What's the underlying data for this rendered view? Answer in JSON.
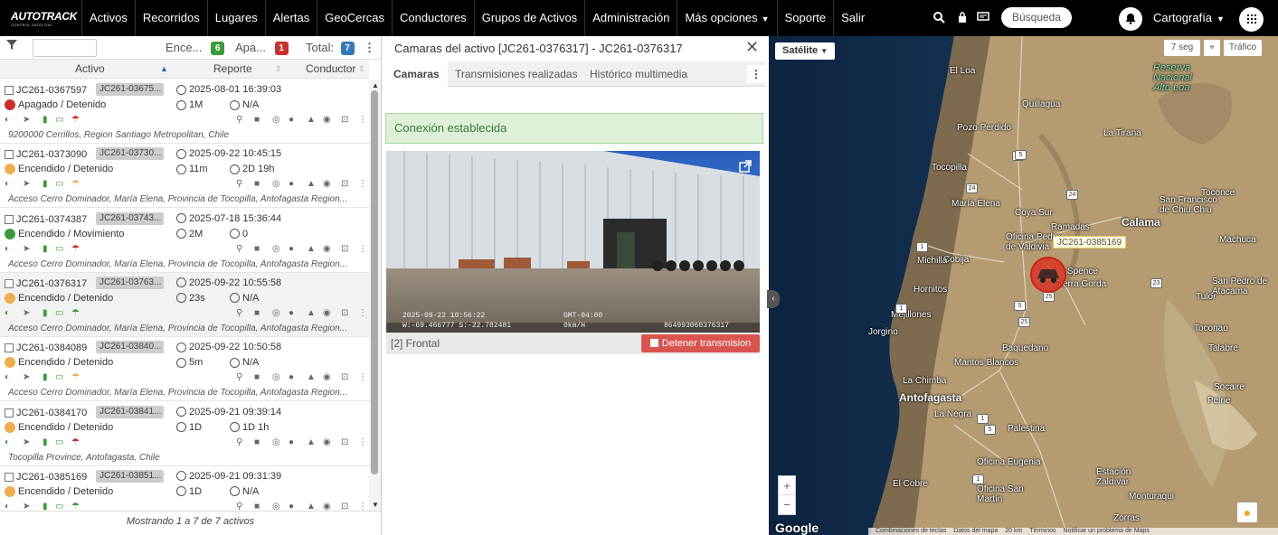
{
  "header": {
    "logo_text": "AUTOTRACK",
    "logo_sub": "CONTROL SATELITAL",
    "nav": [
      "Activos",
      "Recorridos",
      "Lugares",
      "Alertas",
      "GeoCercas",
      "Conductores",
      "Grupos de Activos",
      "Administración",
      "Más opciones",
      "Soporte",
      "Salir"
    ],
    "search_label": "Búsqueda",
    "map_layer_label": "Cartografía"
  },
  "asset_list": {
    "counts": {
      "on_label": "Ence...",
      "on_count": "6",
      "off_label": "Apa...",
      "off_count": "1",
      "total_label": "Total:",
      "total_count": "7"
    },
    "columns": {
      "asset": "Activo",
      "report": "Reporte",
      "driver": "Conductor"
    },
    "rows": [
      {
        "id": "JC261-0367597",
        "chip": "JC261-03675...",
        "report": "2025-08-01 16:39:03",
        "status": "Apagado / Detenido",
        "status_color": "#c9302c",
        "m1": "1M",
        "m2": "N/A",
        "address": "9200000 Cerrillos, Region Santiago Metropolitan, Chile",
        "selected": false
      },
      {
        "id": "JC261-0373090",
        "chip": "JC261-03730...",
        "report": "2025-09-22 10:45:15",
        "status": "Encendido / Detenido",
        "status_color": "#f0ad4e",
        "m1": "11m",
        "m2": "2D 19h",
        "address": "Acceso Cerro Dominador, María Elena, Provincia de Tocopilla, Antofagasta Region...",
        "selected": false
      },
      {
        "id": "JC261-0374387",
        "chip": "JC261-03743...",
        "report": "2025-07-18 15:36:44",
        "status": "Encendido / Movimiento",
        "status_color": "#3c9a3c",
        "m1": "2M",
        "m2": "0",
        "address": "Acceso Cerro Dominador, María Elena, Provincia de Tocopilla, Antofagasta Region...",
        "selected": false
      },
      {
        "id": "JC261-0376317",
        "chip": "JC261-03763...",
        "report": "2025-09-22 10:55:58",
        "status": "Encendido / Detenido",
        "status_color": "#f0ad4e",
        "m1": "23s",
        "m2": "N/A",
        "address": "Acceso Cerro Dominador, María Elena, Provincia de Tocopilla, Antofagasta Region...",
        "selected": true
      },
      {
        "id": "JC261-0384089",
        "chip": "JC261-03840...",
        "report": "2025-09-22 10:50:58",
        "status": "Encendido / Detenido",
        "status_color": "#f0ad4e",
        "m1": "5m",
        "m2": "N/A",
        "address": "Acceso Cerro Dominador, María Elena, Provincia de Tocopilla, Antofagasta Region...",
        "selected": false
      },
      {
        "id": "JC261-0384170",
        "chip": "JC261-03841...",
        "report": "2025-09-21 09:39:14",
        "status": "Encendido / Detenido",
        "status_color": "#f0ad4e",
        "m1": "1D",
        "m2": "1D 1h",
        "address": "Tocopilla Province, Antofagasta, Chile",
        "selected": false
      },
      {
        "id": "JC261-0385169",
        "chip": "JC261-03851...",
        "report": "2025-09-21 09:31:39",
        "status": "Encendido / Detenido",
        "status_color": "#f0ad4e",
        "m1": "1D",
        "m2": "N/A",
        "address": "",
        "selected": false
      }
    ],
    "footer": "Mostrando 1 a 7 de 7 activos"
  },
  "camera_panel": {
    "title": "Camaras del activo [JC261-0376317] - JC261-0376317",
    "tabs": [
      "Camaras",
      "Transmisiones realizadas",
      "Histórico multimedia"
    ],
    "connection_status": "Conexión establecida",
    "overlay_left": "2025-09-22 10:56:22",
    "overlay_left2": "W:-69.466777 S:-22.782481",
    "overlay_right": "GMT-04:00",
    "overlay_right2": "0km/H",
    "overlay_id": "864993060376317",
    "camera_label": "[2] Frontal",
    "stop_button": "Detener transmision"
  },
  "map": {
    "type_button": "Satélite",
    "refresh_label": "7 seg",
    "traffic_label": "Tráfico",
    "vehicle_label": "JC261-0385169",
    "places": [
      {
        "name": "El Loa",
        "cls": ""
      },
      {
        "name": "Quillagua",
        "cls": ""
      },
      {
        "name": "Pozo Perdido",
        "cls": ""
      },
      {
        "name": "La Tirana",
        "cls": ""
      },
      {
        "name": "Tocopilla",
        "cls": ""
      },
      {
        "name": "María Elena",
        "cls": ""
      },
      {
        "name": "Coya Sur",
        "cls": ""
      },
      {
        "name": "Ramadas",
        "cls": ""
      },
      {
        "name": "Calama",
        "cls": "big"
      },
      {
        "name": "San Francisco de Chiu Chiu",
        "cls": ""
      },
      {
        "name": "Toconce",
        "cls": ""
      },
      {
        "name": "Cobija",
        "cls": ""
      },
      {
        "name": "Oficina Pedro de Valdivia",
        "cls": ""
      },
      {
        "name": "Michilla",
        "cls": ""
      },
      {
        "name": "Spence",
        "cls": ""
      },
      {
        "name": "Sierra Gorda",
        "cls": ""
      },
      {
        "name": "Hornitos",
        "cls": ""
      },
      {
        "name": "Mejillones",
        "cls": ""
      },
      {
        "name": "Jorgino",
        "cls": ""
      },
      {
        "name": "Baquedano",
        "cls": ""
      },
      {
        "name": "Mantos Blancos",
        "cls": ""
      },
      {
        "name": "La Chimba",
        "cls": ""
      },
      {
        "name": "Antofagasta",
        "cls": "big"
      },
      {
        "name": "La Negra",
        "cls": ""
      },
      {
        "name": "Palestina",
        "cls": ""
      },
      {
        "name": "Oficina Eugenia",
        "cls": ""
      },
      {
        "name": "Oficina San Martín",
        "cls": ""
      },
      {
        "name": "El Cobre",
        "cls": ""
      },
      {
        "name": "Estación Zaldívar",
        "cls": ""
      },
      {
        "name": "Monturaqui",
        "cls": ""
      },
      {
        "name": "Zorras",
        "cls": ""
      },
      {
        "name": "Tulor",
        "cls": ""
      },
      {
        "name": "San Pedro de Atacama",
        "cls": ""
      },
      {
        "name": "Toconao",
        "cls": ""
      },
      {
        "name": "Talabre",
        "cls": ""
      },
      {
        "name": "Socaire",
        "cls": ""
      },
      {
        "name": "Peine",
        "cls": ""
      },
      {
        "name": "Machuca",
        "cls": ""
      },
      {
        "name": "Reserva Nacional Alto Loa",
        "cls": "park"
      }
    ],
    "routes": [
      "5",
      "24",
      "24",
      "1",
      "1",
      "5",
      "25",
      "5",
      "23",
      "1",
      "1",
      "25",
      "5"
    ],
    "google": "Google",
    "footer_items": [
      "Combinaciones de teclas",
      "Datos del mapa",
      "20 km",
      "Términos",
      "Notificar un problema de Maps"
    ]
  }
}
